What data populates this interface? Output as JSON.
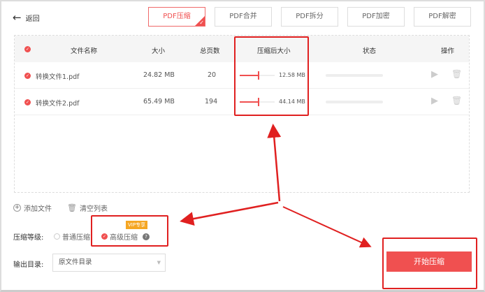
{
  "header": {
    "back_label": "返回"
  },
  "tabs": [
    {
      "label": "PDF压缩",
      "active": true
    },
    {
      "label": "PDF合并"
    },
    {
      "label": "PDF拆分"
    },
    {
      "label": "PDF加密"
    },
    {
      "label": "PDF解密"
    }
  ],
  "table": {
    "columns": [
      "文件名称",
      "大小",
      "总页数",
      "压缩后大小",
      "状态",
      "操作"
    ],
    "rows": [
      {
        "name": "转换文件1.pdf",
        "size": "24.82 MB",
        "pages": "20",
        "compressed": "12.58 MB",
        "ratio": 0.55
      },
      {
        "name": "转换文件2.pdf",
        "size": "65.49 MB",
        "pages": "194",
        "compressed": "44.14 MB",
        "ratio": 0.55
      }
    ]
  },
  "actions": {
    "add_file": "添加文件",
    "clear_list": "清空列表"
  },
  "compression": {
    "label": "压缩等级:",
    "normal": "普通压缩",
    "advanced": "高级压缩",
    "vip_badge": "VIP专享"
  },
  "output": {
    "label": "输出目录:",
    "value": "原文件目录"
  },
  "start_button": "开始压缩",
  "colors": {
    "accent": "#f05050",
    "annotation": "#e02020",
    "vip": "#f5a623"
  }
}
